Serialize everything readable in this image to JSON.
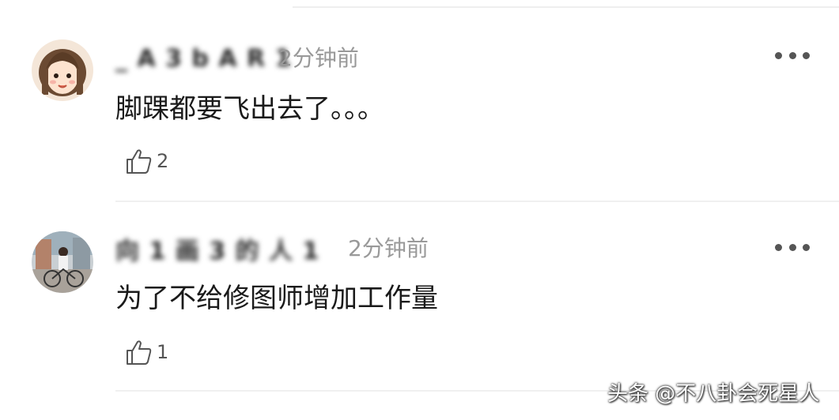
{
  "comments": [
    {
      "username": "_ A 3 b A R 1",
      "timestamp": "2分钟前",
      "text": "脚踝都要飞出去了。。。",
      "likes": "2",
      "avatar_icon": "cartoon-girl-avatar-icon"
    },
    {
      "username": "向 1 画 3 的 人 1",
      "timestamp": "2分钟前",
      "text": "为了不给修图师增加工作量",
      "likes": "1",
      "avatar_icon": "photo-cyclist-avatar-icon"
    }
  ],
  "watermark": "头条 @不八卦会死星人",
  "colors": {
    "text": "#1a1a1a",
    "meta": "#999999",
    "background": "#ffffff"
  }
}
